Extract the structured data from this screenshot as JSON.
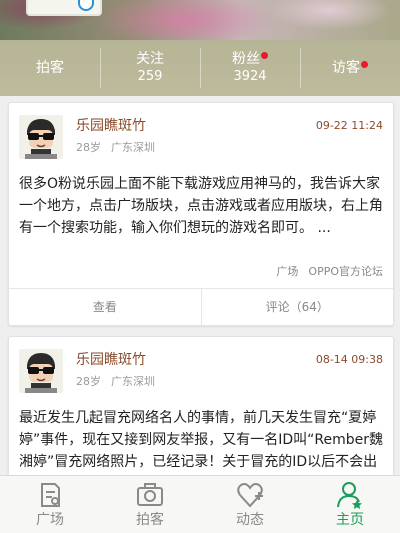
{
  "header": {
    "stats": [
      {
        "label": "拍客",
        "num": "",
        "dot": false
      },
      {
        "label": "关注",
        "num": "259",
        "dot": false
      },
      {
        "label": "粉丝",
        "num": "3924",
        "dot": true
      },
      {
        "label": "访客",
        "num": "",
        "dot": true
      }
    ]
  },
  "posts": [
    {
      "author": "乐园瞧斑竹",
      "age": "28岁",
      "location": "广东深圳",
      "time": "09-22 11:24",
      "content": "很多O粉说乐园上面不能下载游戏应用神马的，我告诉大家一个地方，点击广场版块，点击游戏或者应用版块，右上角有一个搜索功能，输入你们想玩的游戏名即可。 ...",
      "tags": [
        "广场",
        "OPPO官方论坛"
      ],
      "actions": {
        "view": "查看",
        "comment": "评论（64）"
      }
    },
    {
      "author": "乐园瞧斑竹",
      "age": "28岁",
      "location": "广东深圳",
      "time": "08-14 09:38",
      "content": "最近发生几起冒充网络名人的事情，前几天发生冒充“夏婷婷”事件，现在又接到网友举报，又有一名ID叫“Rember魏湘婷”冒充网络照片，已经记录！关于冒充的ID以后不会出现在oppo乐园广场版本 ..."
    }
  ],
  "nav": {
    "items": [
      {
        "label": "广场",
        "icon": "square-icon"
      },
      {
        "label": "拍客",
        "icon": "camera-icon"
      },
      {
        "label": "动态",
        "icon": "heart-plus-icon"
      },
      {
        "label": "主页",
        "icon": "user-icon"
      }
    ],
    "active_color": "#1e9c5a"
  }
}
